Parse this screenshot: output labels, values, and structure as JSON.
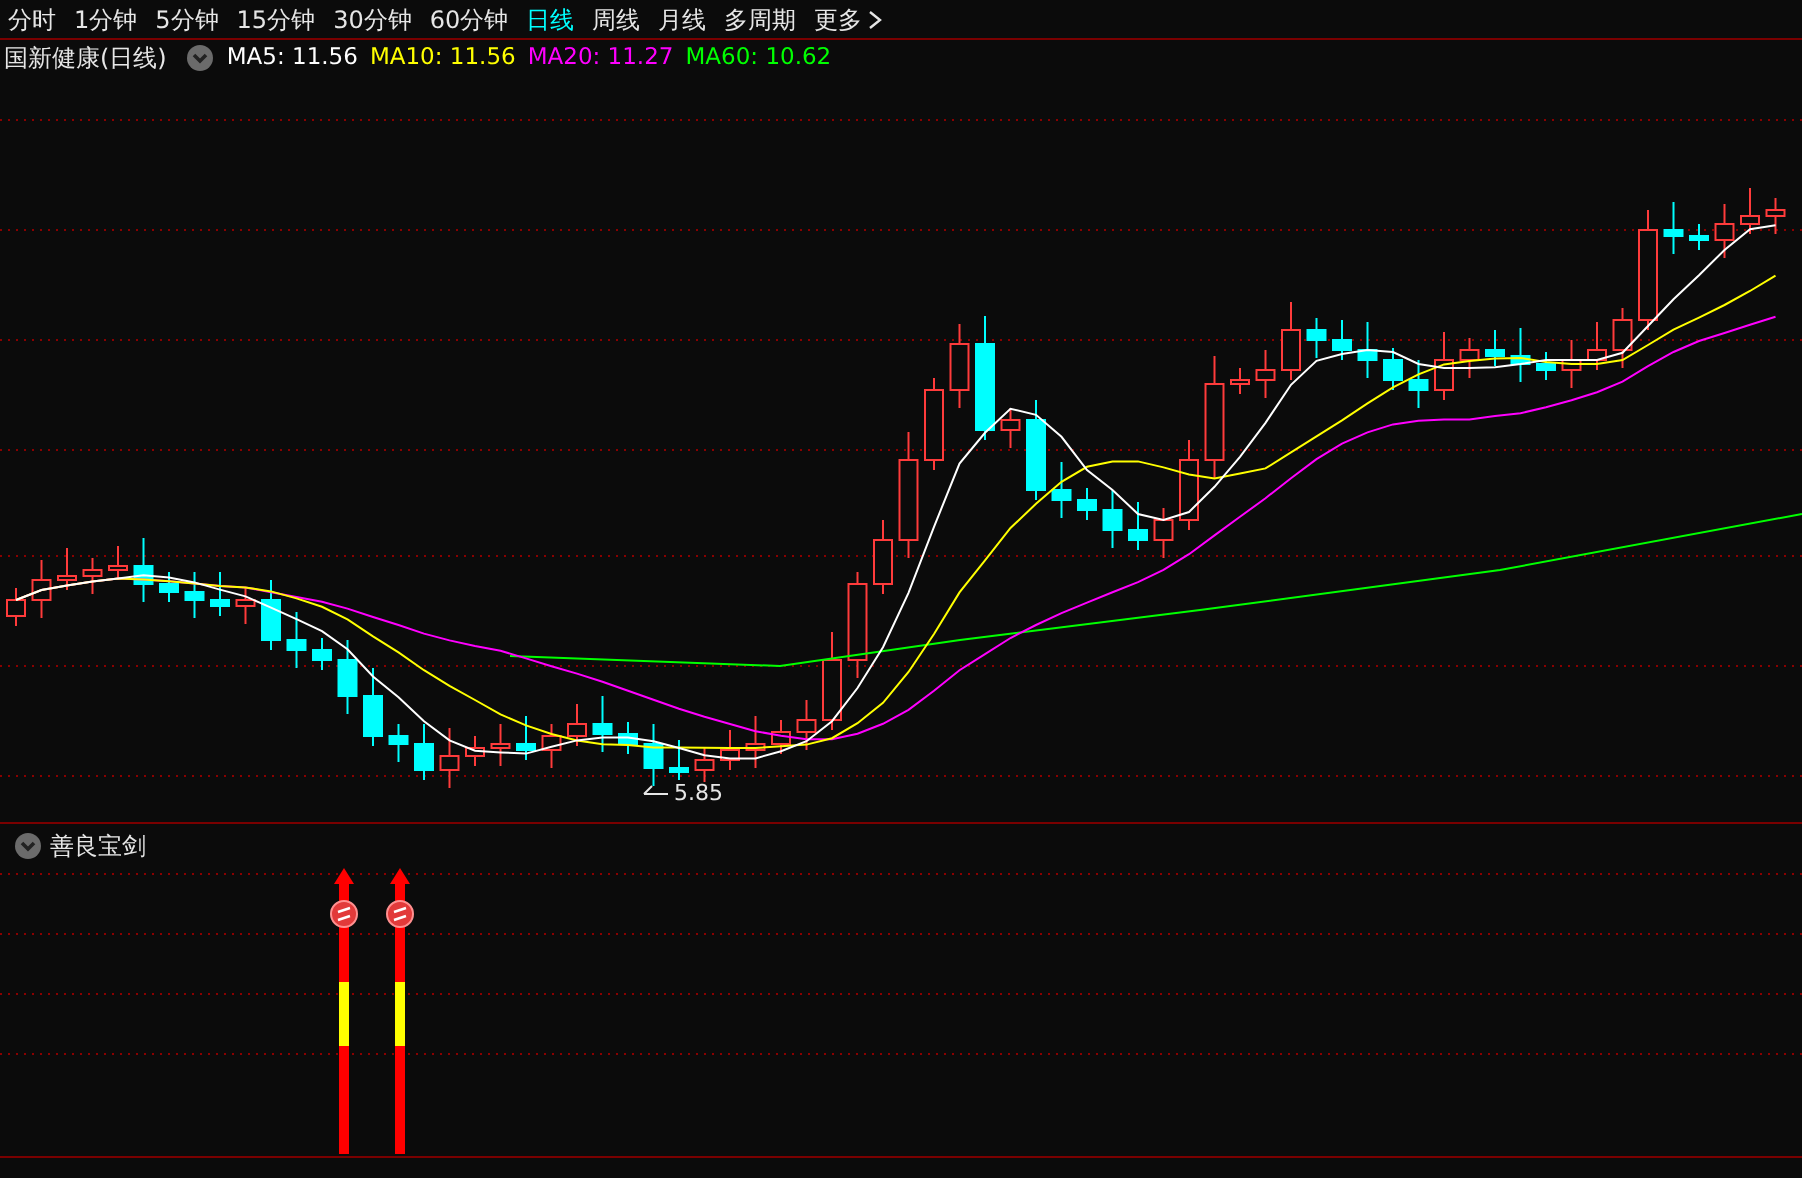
{
  "tabs": [
    {
      "label": "分时",
      "selected": false,
      "kind": "period"
    },
    {
      "label": "1分钟",
      "selected": false,
      "kind": "period"
    },
    {
      "label": "5分钟",
      "selected": false,
      "kind": "period"
    },
    {
      "label": "15分钟",
      "selected": false,
      "kind": "period"
    },
    {
      "label": "30分钟",
      "selected": false,
      "kind": "period"
    },
    {
      "label": "60分钟",
      "selected": false,
      "kind": "period"
    },
    {
      "label": "日线",
      "selected": true,
      "kind": "period"
    },
    {
      "label": "周线",
      "selected": false,
      "kind": "period"
    },
    {
      "label": "月线",
      "selected": false,
      "kind": "period"
    },
    {
      "label": "多周期",
      "selected": false,
      "kind": "period"
    },
    {
      "label": "更多",
      "selected": false,
      "kind": "menu"
    }
  ],
  "main_chart": {
    "title": "国新健康(日线)",
    "moving_averages": [
      {
        "label": "MA5:",
        "value": "11.56",
        "color": "#ffffff"
      },
      {
        "label": "MA10:",
        "value": "11.56",
        "color": "#ffff00"
      },
      {
        "label": "MA20:",
        "value": "11.27",
        "color": "#ff00ff"
      },
      {
        "label": "MA60:",
        "value": "10.62",
        "color": "#00ff00"
      }
    ],
    "low_marker": "5.85"
  },
  "indicator_panel": {
    "title": "善良宝剑"
  }
}
